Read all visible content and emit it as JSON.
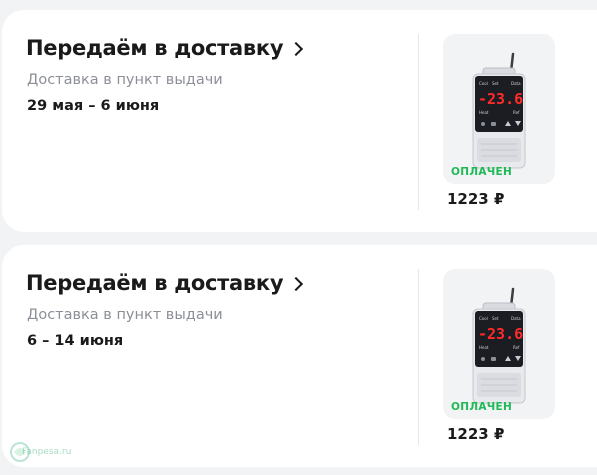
{
  "orders": [
    {
      "title": "Передаём в доставку",
      "subtitle": "Доставка в пункт выдачи",
      "dates": "29 мая – 6 июня",
      "status": "ОПЛАЧЕН",
      "price": "1223 ₽",
      "display_value": "-23.6"
    },
    {
      "title": "Передаём в доставку",
      "subtitle": "Доставка в пункт выдачи",
      "dates": "6 – 14 июня",
      "status": "ОПЛАЧЕН",
      "price": "1223 ₽",
      "display_value": "-23.6"
    }
  ],
  "device_labels": {
    "cool": "Cool",
    "set": "Set",
    "data": "Data",
    "heat": "Heat",
    "ref": "Ref"
  },
  "watermark": "Fanpesa.ru",
  "colors": {
    "status_green": "#1fb955",
    "background": "#f2f3f5",
    "card": "#ffffff"
  }
}
